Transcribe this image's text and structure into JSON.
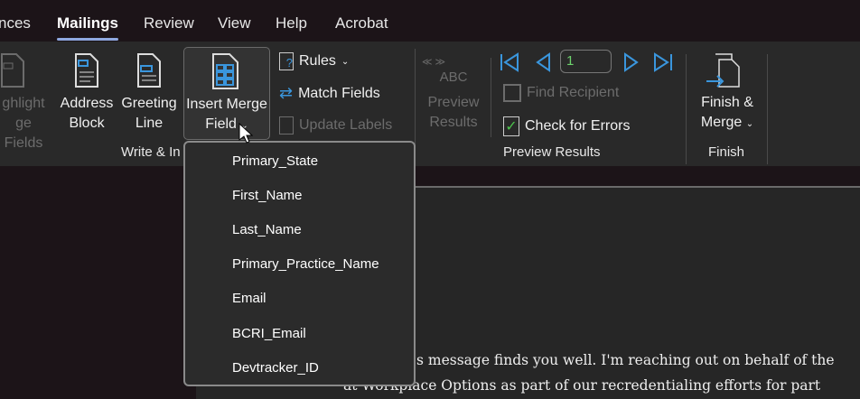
{
  "tabs": [
    "nces",
    "Mailings",
    "Review",
    "View",
    "Help",
    "Acrobat"
  ],
  "ribbon": {
    "highlight": [
      "ghlight",
      "ge Fields"
    ],
    "address": [
      "Address",
      "Block"
    ],
    "greeting": [
      "Greeting",
      "Line"
    ],
    "insert_merge": [
      "Insert Merge",
      "Field"
    ],
    "rules": "Rules",
    "match_fields": "Match Fields",
    "update_labels": "Update Labels",
    "write_group": "Write & In",
    "preview_abc": "ABC",
    "preview": [
      "Preview",
      "Results"
    ],
    "record": "1",
    "find_recipient": "Find Recipient",
    "check_errors": "Check for Errors",
    "preview_group": "Preview Results",
    "finish": [
      "Finish &",
      "Merge"
    ],
    "finish_group": "Finish"
  },
  "menu": [
    "Primary_State",
    "First_Name",
    "Last_Name",
    "Primary_Practice_Name",
    "Email",
    "BCRI_Email",
    "Devtracker_ID"
  ],
  "document": {
    "line1": "s message finds you well. I'm reaching out on behalf of the",
    "line2": "at Workplace Options as part of our recredentialing efforts for part"
  }
}
